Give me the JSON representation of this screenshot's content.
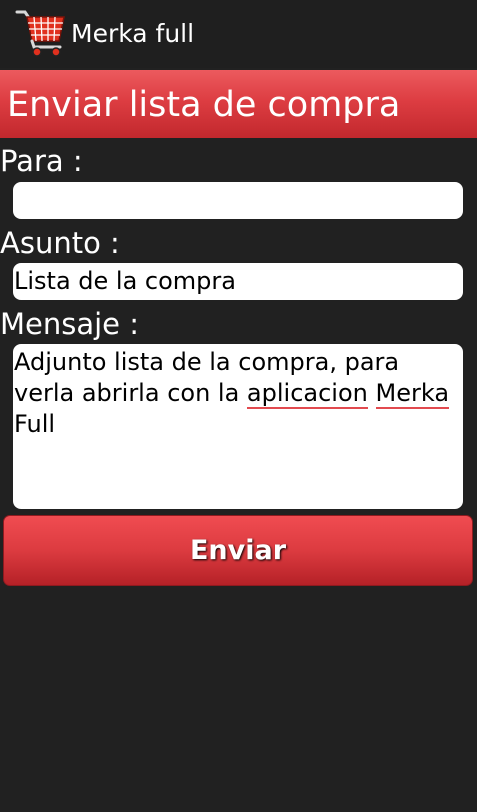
{
  "app_bar": {
    "title": "Merka full",
    "icon": "shopping-cart-icon"
  },
  "header": {
    "title": "Enviar lista de compra"
  },
  "form": {
    "para_label": "Para :",
    "para_value": "",
    "asunto_label": "Asunto :",
    "asunto_value": "Lista de la compra",
    "mensaje_label": "Mensaje :",
    "mensaje_parts": [
      "Adjunto lista de la compra, para verla abrirla con la ",
      "aplicacion",
      " ",
      "Merka",
      " Full"
    ]
  },
  "send_button": {
    "label": "Enviar"
  },
  "colors": {
    "background": "#212121",
    "action_bar": "#1f1f1f",
    "accent_red": "#dd3d42",
    "spell_underline": "#e24a4f"
  }
}
